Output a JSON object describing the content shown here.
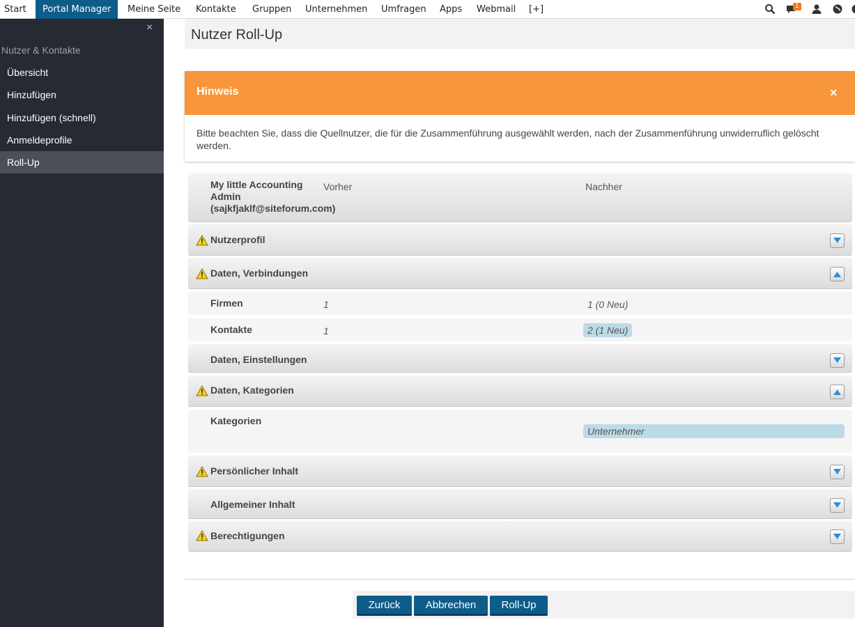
{
  "topnav": {
    "items": [
      {
        "label": "Start"
      },
      {
        "label": "Portal Manager"
      },
      {
        "label": "Meine Seite"
      },
      {
        "label": "Kontakte"
      },
      {
        "label": "Gruppen"
      },
      {
        "label": "Unternehmen"
      },
      {
        "label": "Umfragen"
      },
      {
        "label": "Apps"
      },
      {
        "label": "Webmail"
      },
      {
        "label": "[+]"
      }
    ],
    "active_item": "Portal Manager",
    "messages_badge": "1",
    "accent_color": "#0d5c8a"
  },
  "sidebar": {
    "close_label": "×",
    "section_title": "Nutzer & Kontakte",
    "items": [
      {
        "label": "Übersicht"
      },
      {
        "label": "Hinzufügen"
      },
      {
        "label": "Hinzufügen (schnell)"
      },
      {
        "label": "Anmeldeprofile"
      },
      {
        "label": "Roll-Up"
      }
    ],
    "active_item": "Roll-Up"
  },
  "page": {
    "title": "Nutzer Roll-Up"
  },
  "notice": {
    "title": "Hinweis",
    "close_label": "×",
    "text": "Bitte beachten Sie, dass die Quellnutzer, die für die Zusammenführung ausgewählt werden, nach der Zusammenführung unwiderruflich gelöscht werden.",
    "color": "#f7963b"
  },
  "rollup": {
    "user": "My little Accounting Admin (sajkfjaklf@siteforum.com)",
    "col_before": "Vorher",
    "col_after": "Nachher",
    "sections": [
      {
        "label": "Nutzerprofil",
        "warning": true,
        "expanded": false
      },
      {
        "label": "Daten, Verbindungen",
        "warning": true,
        "expanded": true
      },
      {
        "label": "Daten, Einstellungen",
        "warning": false,
        "expanded": false
      },
      {
        "label": "Daten, Kategorien",
        "warning": true,
        "expanded": true
      },
      {
        "label": "Persönlicher Inhalt",
        "warning": true,
        "expanded": false
      },
      {
        "label": "Allgemeiner Inhalt",
        "warning": false,
        "expanded": false
      },
      {
        "label": "Berechtigungen",
        "warning": true,
        "expanded": false
      }
    ],
    "connections": [
      {
        "label": "Firmen",
        "before": "1",
        "after": "1 (0 Neu)",
        "changed": false
      },
      {
        "label": "Kontakte",
        "before": "1",
        "after": "2 (1 Neu)",
        "changed": true
      }
    ],
    "categories": {
      "label": "Kategorien",
      "after": "Unternehmer"
    }
  },
  "actions": {
    "back": "Zurück",
    "cancel": "Abbrechen",
    "rollup": "Roll-Up"
  }
}
